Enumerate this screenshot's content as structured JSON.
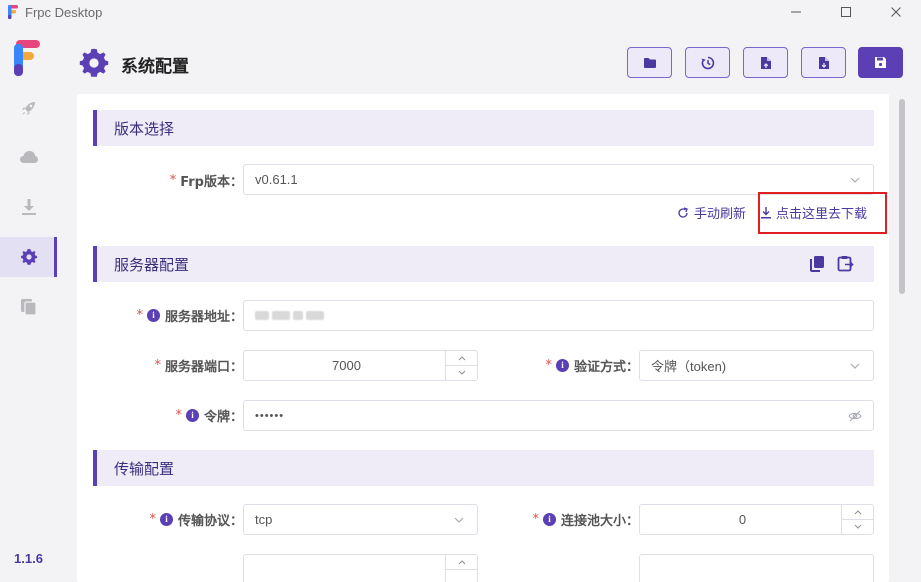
{
  "window": {
    "title": "Frpc Desktop",
    "controls": [
      "minimize-icon",
      "maximize-icon",
      "close-icon"
    ]
  },
  "sidebar": {
    "items": [
      {
        "name": "rocket-icon",
        "active": false
      },
      {
        "name": "cloud-icon",
        "active": false
      },
      {
        "name": "download-icon",
        "active": false
      },
      {
        "name": "gear-icon",
        "active": true
      },
      {
        "name": "file-copy-icon",
        "active": false
      }
    ],
    "version": "1.1.6"
  },
  "header": {
    "title": "系统配置",
    "toolbar": [
      "folder-icon",
      "history-icon",
      "file-export-icon",
      "file-import-icon",
      "save-icon"
    ]
  },
  "colors": {
    "accent": "#5a3fb5",
    "section_bg": "#efecf8",
    "required": "#e05050",
    "highlight": "#e02020"
  },
  "sections": {
    "version": {
      "title": "版本选择",
      "frp_version_label": "Frp版本：",
      "frp_version_value": "v0.61.1",
      "refresh_link": "手动刷新",
      "download_link": "点击这里去下载"
    },
    "server": {
      "title": "服务器配置",
      "address_label": "服务器地址：",
      "port_label": "服务器端口：",
      "port_value": "7000",
      "auth_label": "验证方式：",
      "auth_value": "令牌（token)",
      "token_label": "令牌：",
      "token_value": "••••••"
    },
    "transport": {
      "title": "传输配置",
      "protocol_label": "传输协议：",
      "protocol_value": "tcp",
      "pool_label": "连接池大小：",
      "pool_value": "0"
    }
  }
}
